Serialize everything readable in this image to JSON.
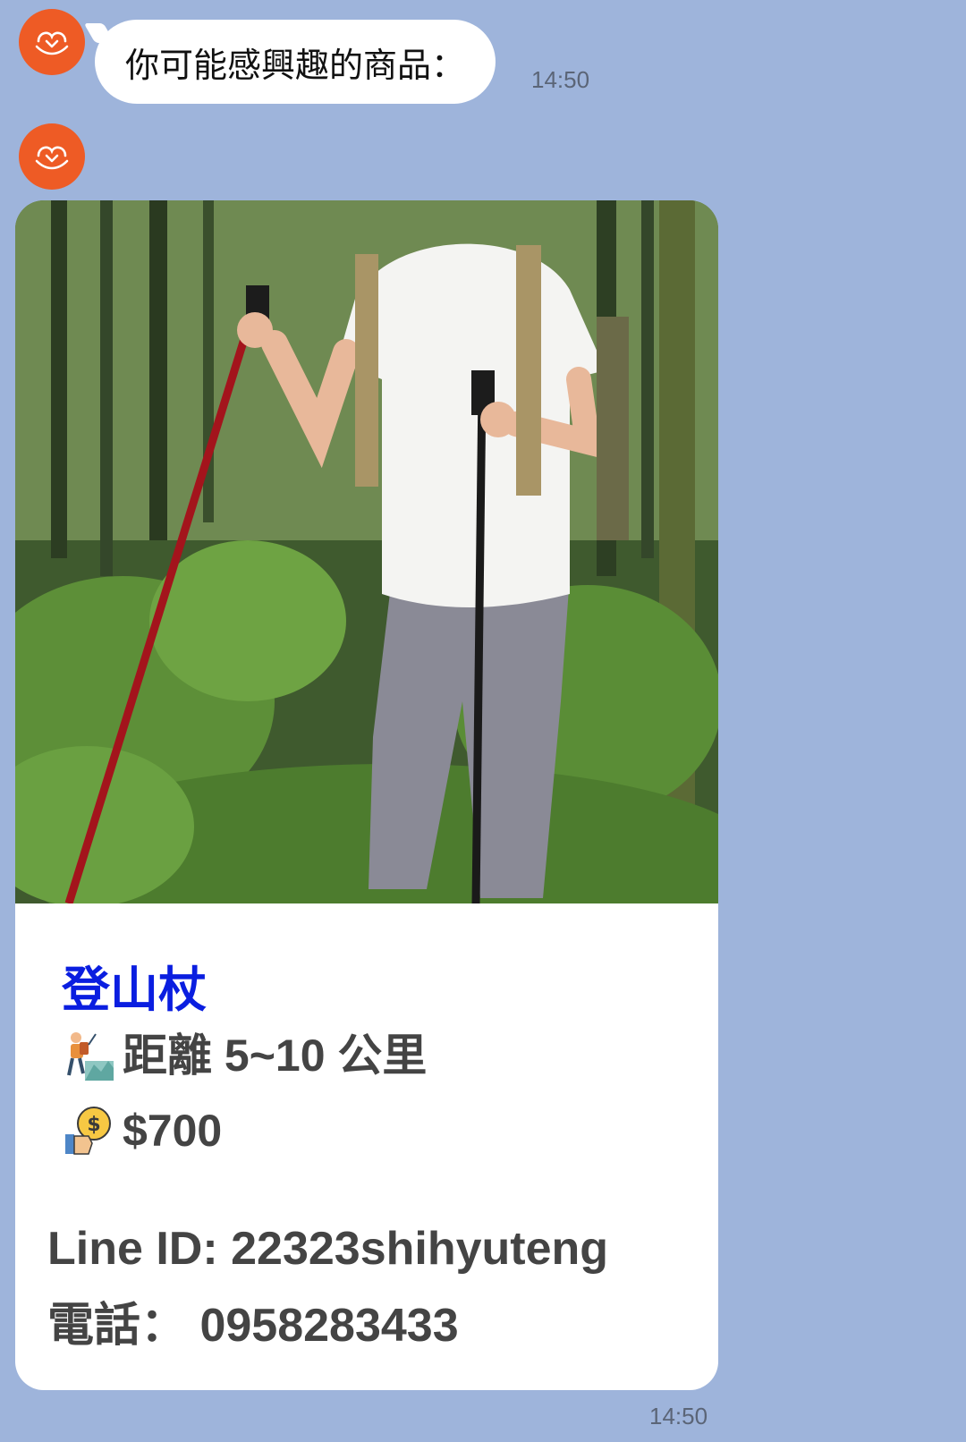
{
  "chat": {
    "message1": {
      "text": "你可能感興趣的商品：",
      "time": "14:50"
    },
    "product_card": {
      "image_alt": "hiker with trekking poles in forest",
      "title": "登山杖",
      "distance": "距離 5~10 公里",
      "distance_icon": "hiker-icon",
      "price": "$700",
      "price_icon": "money-hand-icon",
      "line_id": "Line ID: 22323shihyuteng",
      "phone": "電話： 0958283433",
      "time": "14:50"
    },
    "avatar_icon": "hands-heart-icon"
  },
  "colors": {
    "background": "#9eb4db",
    "avatar": "#ee5b25",
    "title": "#0a1ee0",
    "text": "#444444"
  }
}
